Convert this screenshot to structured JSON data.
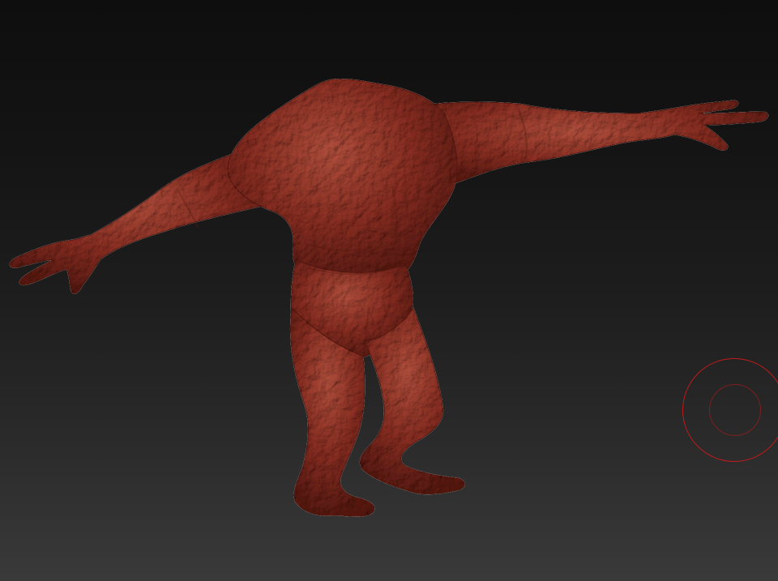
{
  "app": {
    "type": "3d-sculpt-viewport"
  },
  "viewport": {
    "background": "dark-gradient",
    "model": {
      "subject": "headless-creature-sculpt",
      "pose": "t-pose",
      "surface": "bumpy-skin",
      "color": "#8a2e22",
      "shade_color": "#5a1a12",
      "highlight_color": "#b4503e"
    },
    "brush_cursor": {
      "color": "#c21a1a",
      "icon": "brush-circle-icon"
    }
  }
}
